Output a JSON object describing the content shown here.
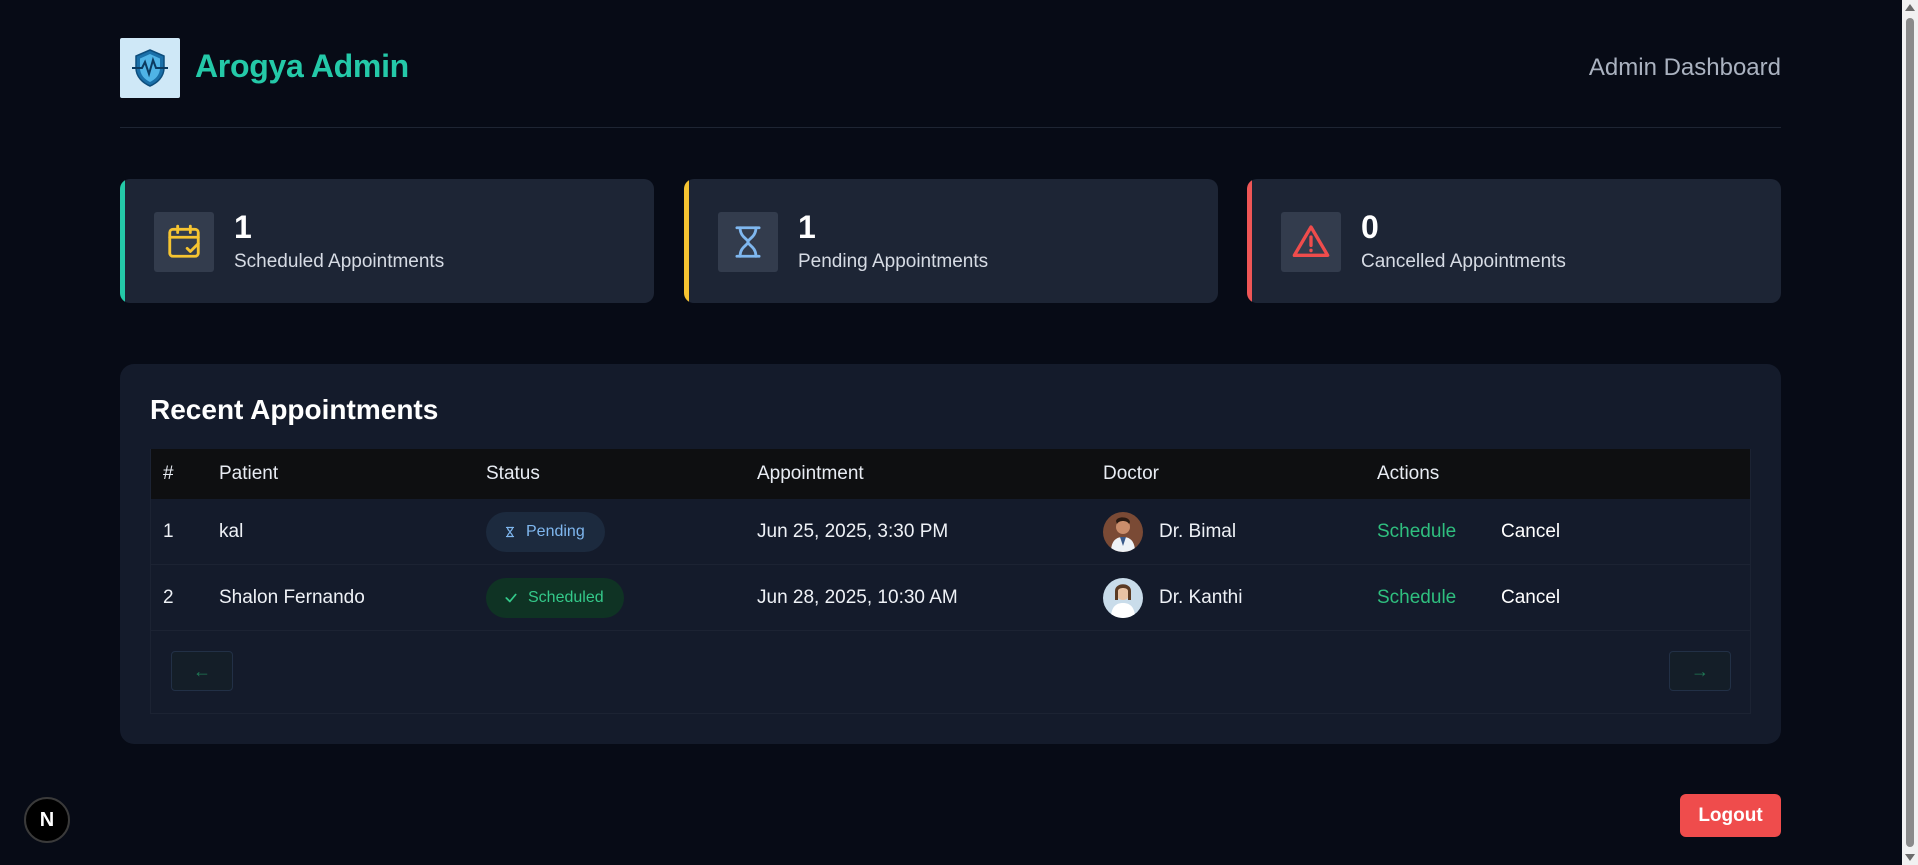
{
  "header": {
    "brand": "Arogya Admin",
    "right_title": "Admin Dashboard",
    "logo_icon": "shield-heartbeat-icon"
  },
  "stats": [
    {
      "value": "1",
      "label": "Scheduled Appointments",
      "accent": "#24c9a8",
      "icon": "calendar-check-icon",
      "icon_color": "#f6c431"
    },
    {
      "value": "1",
      "label": "Pending Appointments",
      "accent": "#f6c431",
      "icon": "hourglass-icon",
      "icon_color": "#7fb7ef"
    },
    {
      "value": "0",
      "label": "Cancelled Appointments",
      "accent": "#ef5656",
      "icon": "warning-triangle-icon",
      "icon_color": "#ef4c4c"
    }
  ],
  "recent": {
    "title": "Recent Appointments",
    "columns": [
      "#",
      "Patient",
      "Status",
      "Appointment",
      "Doctor",
      "Actions"
    ],
    "rows": [
      {
        "index": "1",
        "patient": "kal",
        "status": "Pending",
        "status_type": "pending",
        "appointment": "Jun 25, 2025, 3:30 PM",
        "doctor": "Dr. Bimal",
        "action_schedule": "Schedule",
        "action_cancel": "Cancel"
      },
      {
        "index": "2",
        "patient": "Shalon Fernando",
        "status": "Scheduled",
        "status_type": "scheduled",
        "appointment": "Jun 28, 2025, 10:30 AM",
        "doctor": "Dr. Kanthi",
        "action_schedule": "Schedule",
        "action_cancel": "Cancel"
      }
    ],
    "pager_prev": "←",
    "pager_next": "→"
  },
  "logout_label": "Logout",
  "dev_badge": "N",
  "colors": {
    "background": "#070b16",
    "brand": "#24c9a8",
    "danger": "#ef4c4c",
    "success": "#2fbf7f"
  }
}
